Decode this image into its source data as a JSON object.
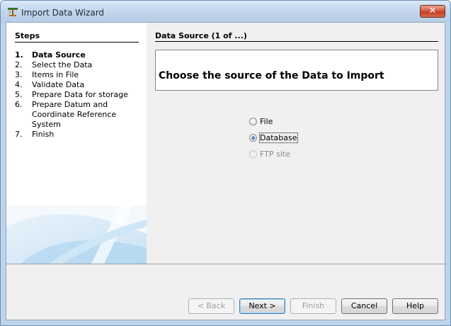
{
  "window": {
    "title": "Import Data Wizard",
    "close_glyph": "✕"
  },
  "steps": {
    "title": "Steps",
    "items": [
      {
        "num": "1.",
        "label": "Data Source",
        "active": true
      },
      {
        "num": "2.",
        "label": "Select the Data"
      },
      {
        "num": "3.",
        "label": "Items in File"
      },
      {
        "num": "4.",
        "label": "Validate Data"
      },
      {
        "num": "5.",
        "label": "Prepare Data for storage"
      },
      {
        "num": "6.",
        "label": "Prepare Datum and Coordinate Reference System"
      },
      {
        "num": "7.",
        "label": "Finish"
      }
    ]
  },
  "main": {
    "section_title": "Data Source (1 of ...)",
    "header": "Choose the source of the Data to Import",
    "options": [
      {
        "label": "File",
        "selected": false,
        "enabled": true
      },
      {
        "label": "Database",
        "selected": true,
        "enabled": true
      },
      {
        "label": "FTP site",
        "selected": false,
        "enabled": false
      }
    ]
  },
  "buttons": {
    "back": "< Back",
    "next": "Next >",
    "finish": "Finish",
    "cancel": "Cancel",
    "help": "Help"
  }
}
